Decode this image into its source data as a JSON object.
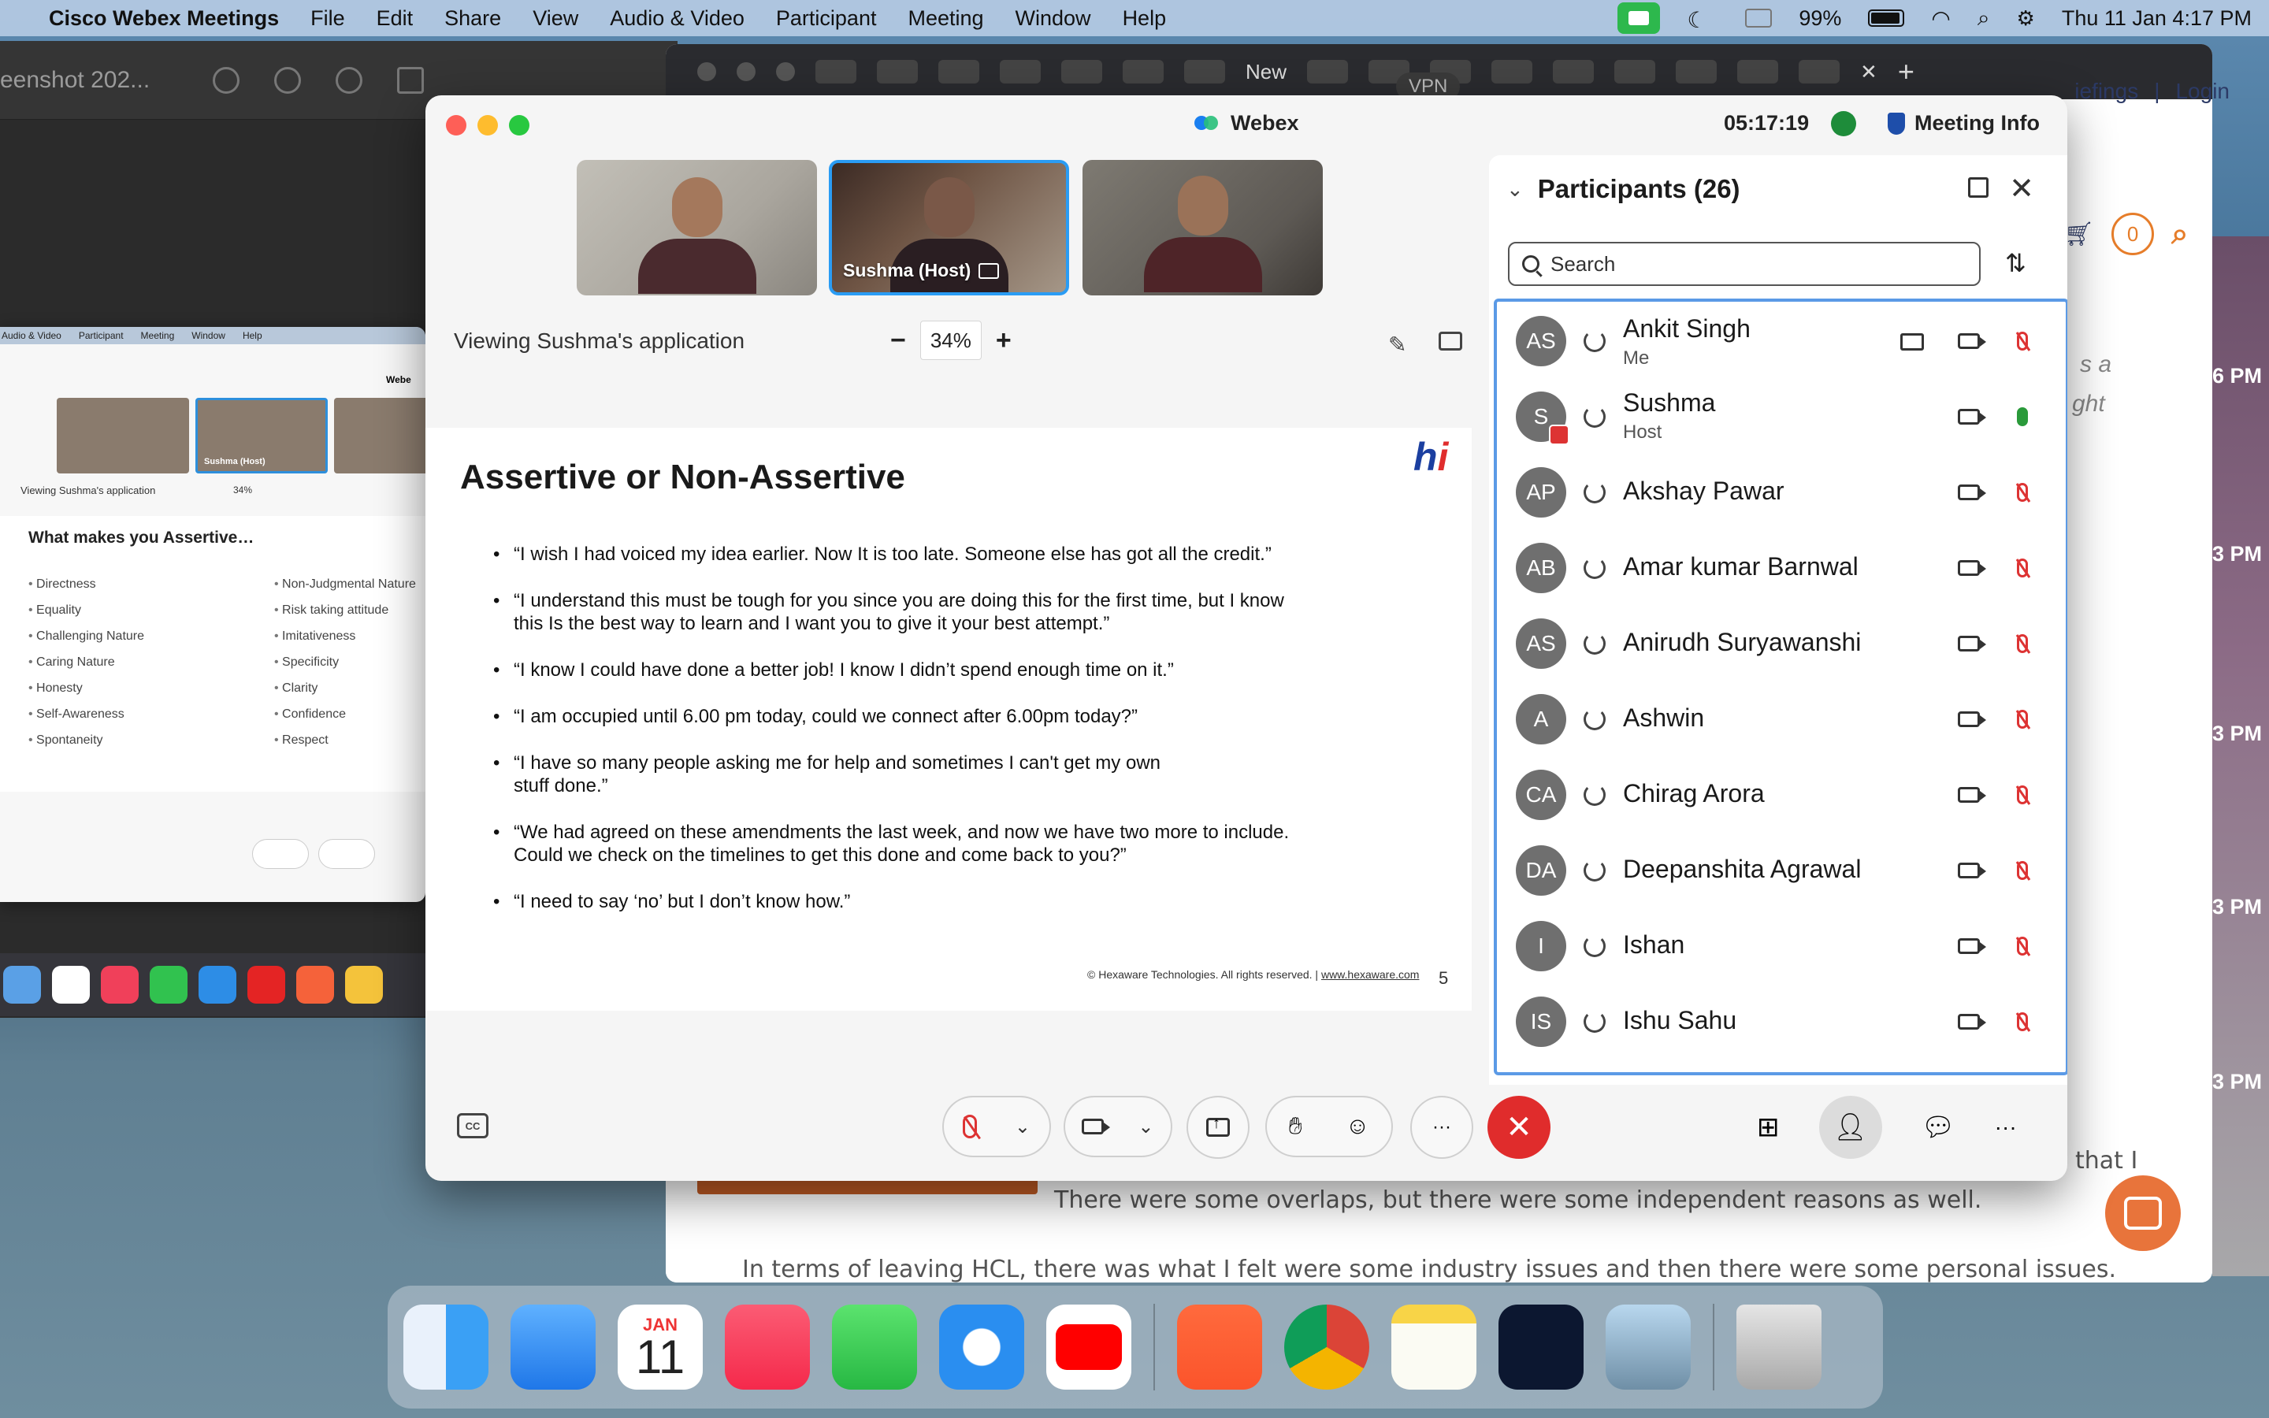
{
  "menubar": {
    "app": "Cisco Webex Meetings",
    "items": [
      "File",
      "Edit",
      "Share",
      "View",
      "Audio & Video",
      "Participant",
      "Meeting",
      "Window",
      "Help"
    ],
    "battery": "99%",
    "datetime": "Thu 11 Jan  4:17 PM"
  },
  "preview": {
    "title": "eenshot 202..."
  },
  "mini_webex": {
    "menu": [
      "Audio & Video",
      "Participant",
      "Meeting",
      "Window",
      "Help"
    ],
    "title": "Webe",
    "host_label": "Sushma  (Host)",
    "viewing": "Viewing Sushma's application",
    "zoom": "34%",
    "slide_title": "What makes you Assertive…",
    "col1": [
      "Directness",
      "Equality",
      "Challenging Nature",
      "Caring Nature",
      "Honesty",
      "Self-Awareness",
      "Spontaneity"
    ],
    "col2": [
      "Non-Judgmental Nature",
      "Risk taking attitude",
      "Imitativeness",
      "Specificity",
      "Clarity",
      "Confidence",
      "Respect"
    ]
  },
  "browser": {
    "new_tab": "New",
    "vpn": "VPN",
    "nav_briefings": "iefings",
    "nav_login": "Login",
    "cart_count": "0",
    "text_line1": "There were some overlaps, but there were some independent reasons as well.",
    "text_line2": "In terms of leaving HCL, there was what I felt were some industry issues and then there were some personal issues.",
    "text_that": "that I",
    "italic1": "s a",
    "italic2": "ght"
  },
  "time_strip": [
    "6 PM",
    "3 PM",
    "3 PM",
    "3 PM",
    "3 PM"
  ],
  "webex": {
    "title": "Webex",
    "timer": "05:17:19",
    "meeting_info": "Meeting Info",
    "host_tile_label": "Sushma  (Host)",
    "viewing": "Viewing Sushma's application",
    "zoom": "34%",
    "zoom_minus": "−",
    "zoom_plus": "+",
    "cc": "CC",
    "slide": {
      "title": "Assertive or Non-Assertive",
      "logo_h": "h",
      "logo_i": "i",
      "bullets": [
        "“I wish I had voiced my idea earlier. Now It is too late. Someone else has got all the credit.”",
        "“I understand this must be tough for you since you are doing this for the first time, but I  know this Is the best way to learn and I want you to give it your best attempt.”",
        "“I know I could have done a better job! I know I didn’t spend enough time on it.”",
        "“I am occupied until 6.00 pm today, could we connect after 6.00pm today?”",
        "“I have so many people asking me for help and sometimes I can't get my own stuff done.”",
        "“We had agreed on these amendments the last week, and now we have two more to  include. Could we check on the timelines to get this done and come back to you?”",
        "“I need to say ‘no’ but I don’t know how.”"
      ],
      "footer": "© Hexaware Technologies. All rights reserved. |",
      "footer_link": "www.hexaware.com",
      "page": "5"
    }
  },
  "participants": {
    "header": "Participants (26)",
    "search_placeholder": "Search",
    "list": [
      {
        "initials": "AS",
        "name": "Ankit Singh",
        "role": "Me",
        "mic": "muted",
        "card": true
      },
      {
        "initials": "S",
        "name": "Sushma",
        "role": "Host",
        "mic": "active",
        "card": false,
        "presenter": true
      },
      {
        "initials": "AP",
        "name": "Akshay Pawar",
        "role": "",
        "mic": "muted"
      },
      {
        "initials": "AB",
        "name": "Amar kumar Barnwal",
        "role": "",
        "mic": "muted"
      },
      {
        "initials": "AS",
        "name": "Anirudh Suryawanshi",
        "role": "",
        "mic": "muted"
      },
      {
        "initials": "A",
        "name": "Ashwin",
        "role": "",
        "mic": "muted"
      },
      {
        "initials": "CA",
        "name": "Chirag Arora",
        "role": "",
        "mic": "muted"
      },
      {
        "initials": "DA",
        "name": "Deepanshita Agrawal",
        "role": "",
        "mic": "muted"
      },
      {
        "initials": "I",
        "name": "Ishan",
        "role": "",
        "mic": "muted"
      },
      {
        "initials": "IS",
        "name": "Ishu Sahu",
        "role": "",
        "mic": "muted"
      }
    ]
  },
  "dock": {
    "cal_month": "JAN",
    "cal_day": "11"
  },
  "colors": {
    "accent": "#2a9cf4",
    "leave": "#e02c2c",
    "list_border": "#5b9ae6"
  }
}
